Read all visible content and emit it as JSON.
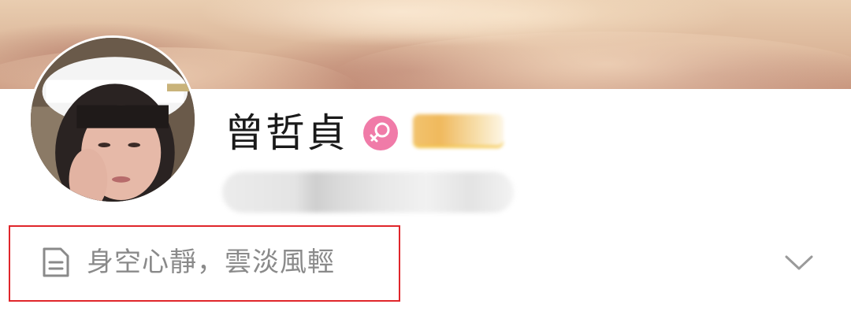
{
  "profile": {
    "name": "曾哲貞",
    "gender_icon": "female-icon",
    "bio": "身空心靜，雲淡風輕",
    "bio_icon": "document-icon",
    "expand_icon": "chevron-down-icon"
  },
  "colors": {
    "gender_badge": "#f07ba8",
    "highlight_border": "#e0262b",
    "name_text": "#1a1a1a",
    "bio_text": "#8a8a8a"
  }
}
